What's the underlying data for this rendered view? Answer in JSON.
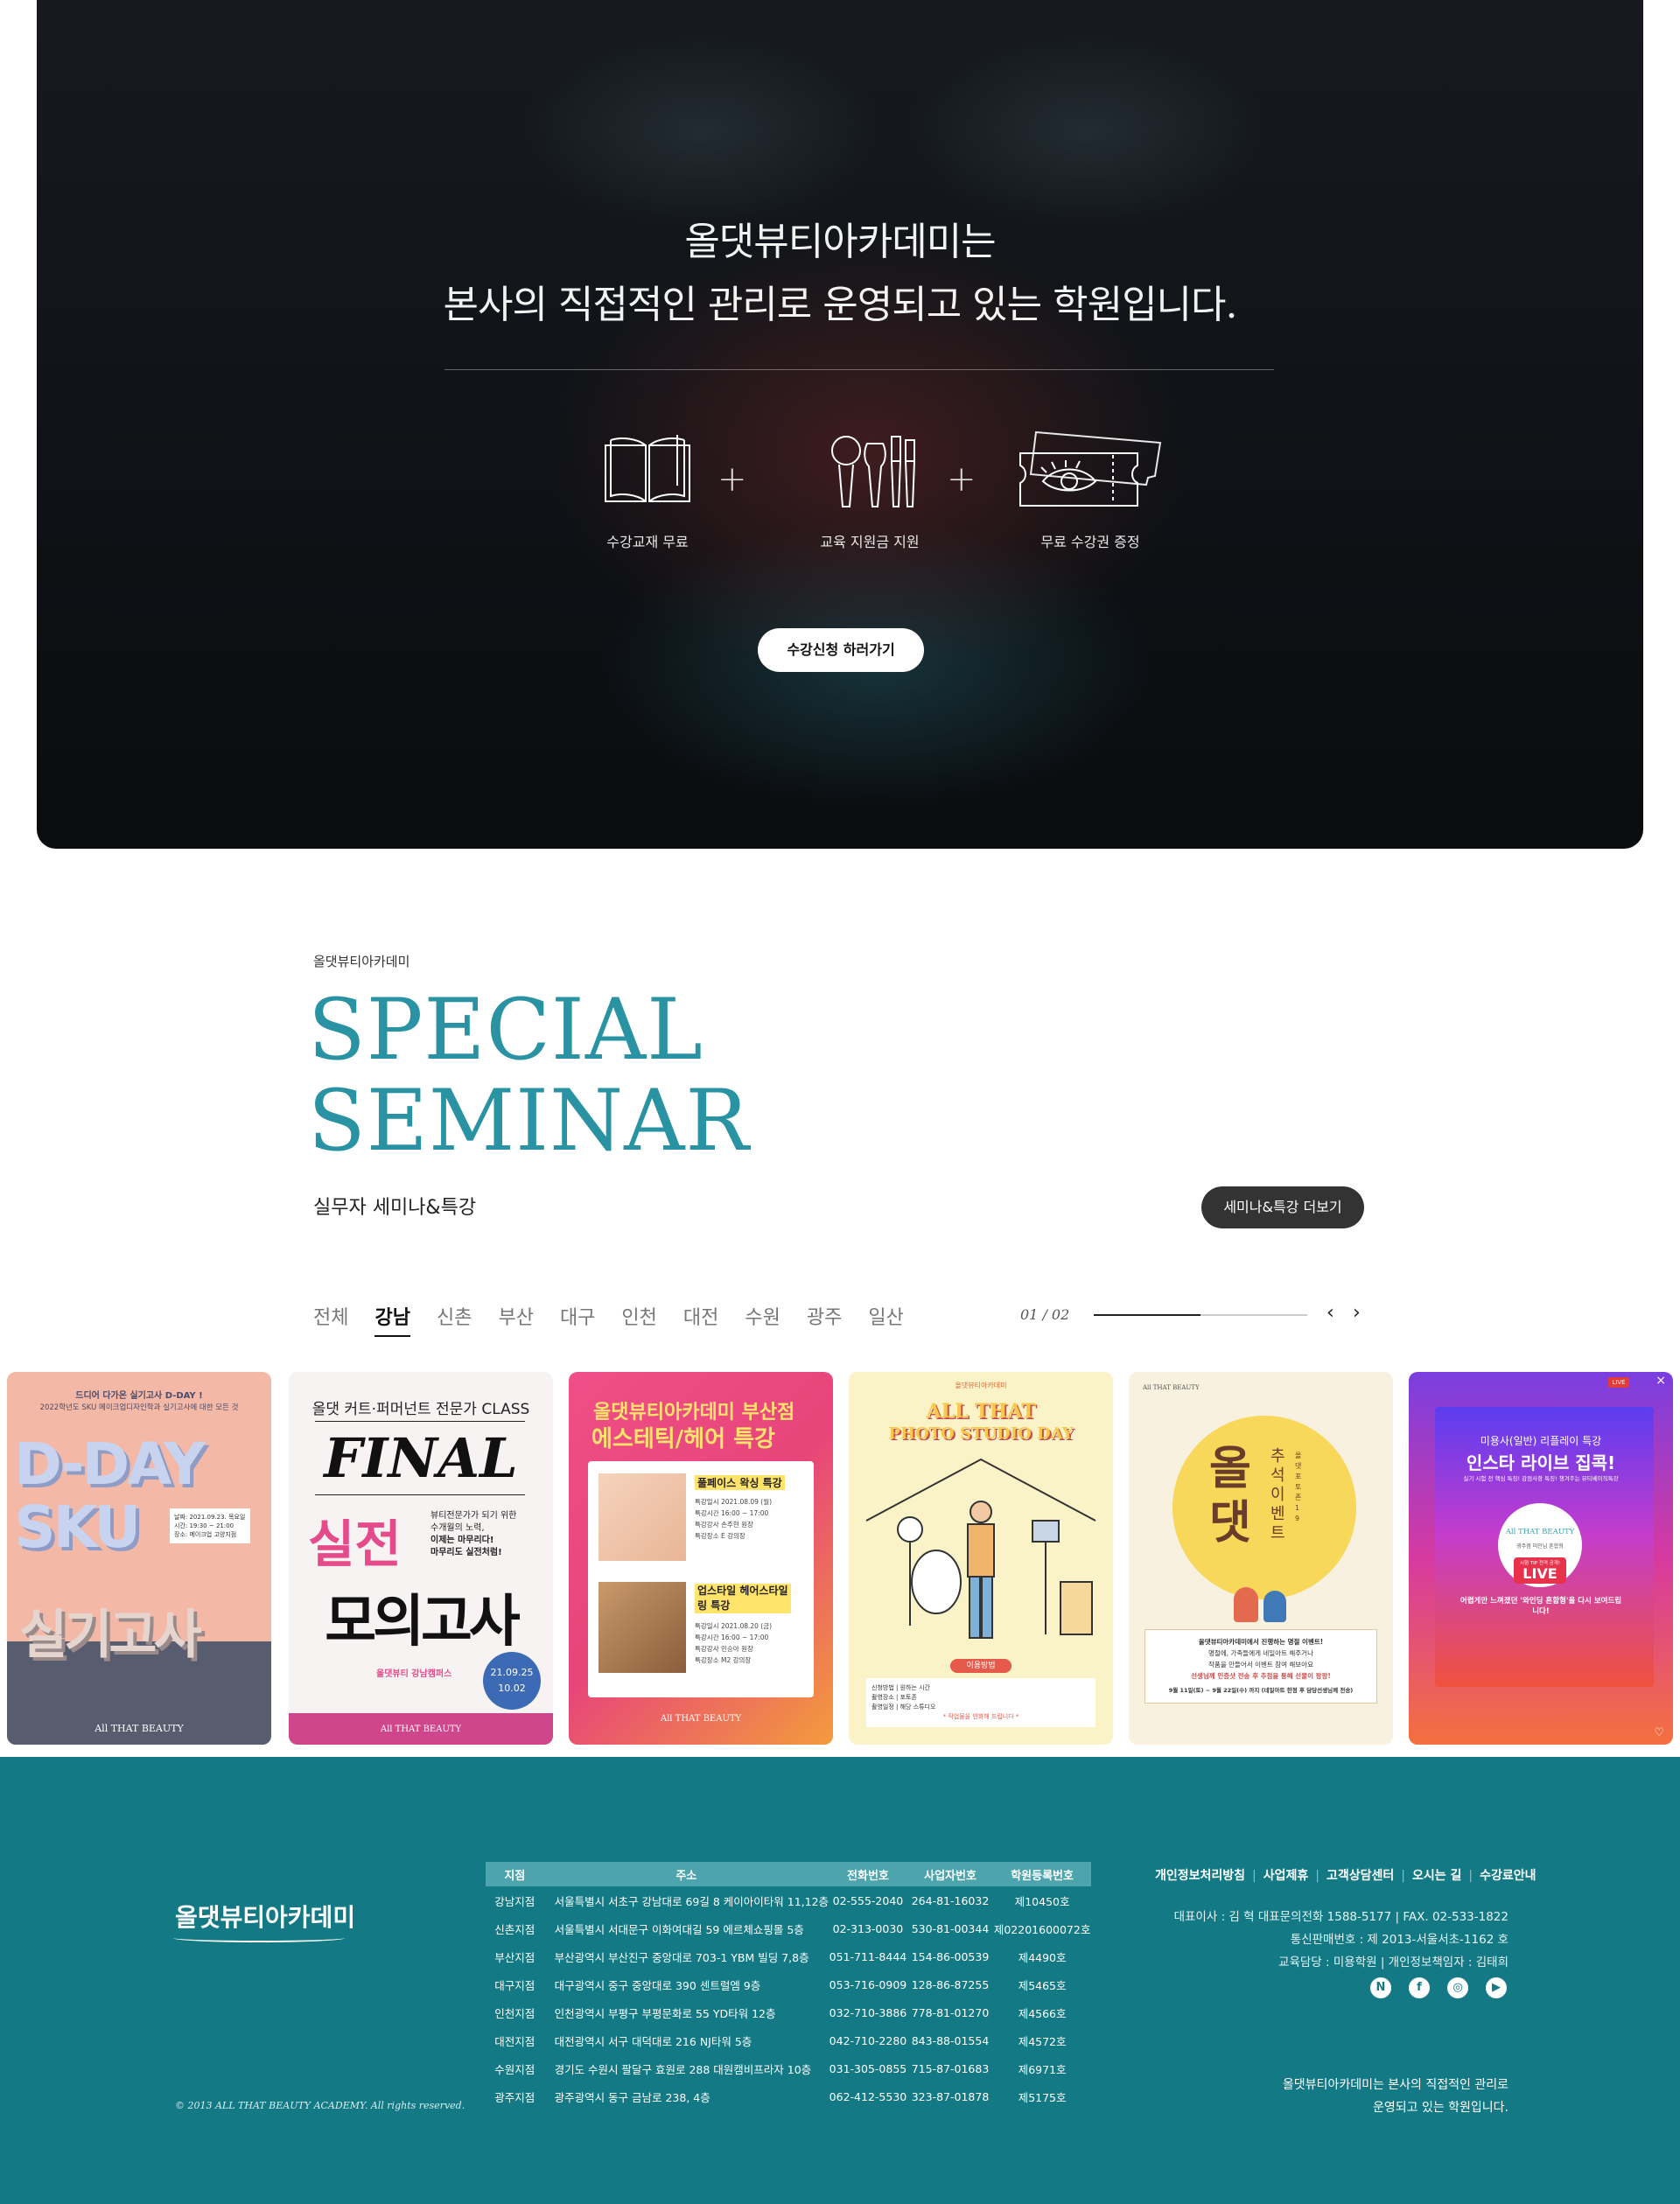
{
  "hero": {
    "title_line1": "올댓뷰티아카데미는",
    "title_line2": "본사의 직접적인 관리로 운영되고 있는 학원입니다.",
    "benefits": [
      {
        "label": "수강교재 무료",
        "icon": "book-icon"
      },
      {
        "label": "교육 지원금 지원",
        "icon": "makeup-brush-icon"
      },
      {
        "label": "무료 수강권 증정",
        "icon": "ticket-eye-icon"
      }
    ],
    "plus": "+",
    "cta_label": "수강신청 하러가기"
  },
  "seminar": {
    "sub": "올댓뷰티아카데미",
    "title_line1": "SPECIAL",
    "title_line2": "SEMINAR",
    "desc": "실무자 세미나&특강",
    "more_label": "세미나&특강 더보기",
    "tabs": [
      "전체",
      "강남",
      "신촌",
      "부산",
      "대구",
      "인천",
      "대전",
      "수원",
      "광주",
      "일산"
    ],
    "active_tab": "강남",
    "pager": "01 / 02",
    "progress": 0.5,
    "prev_icon": "‹",
    "next_icon": "›",
    "cards": [
      {
        "top1": "드디어 다가온 실기고사 D-DAY !",
        "top2": "2022학년도 SKU 메이크업디자인학과 실기고사에 대한 모든 것",
        "big": [
          "D-DAY",
          "SKU",
          "실기고사"
        ],
        "info": [
          "날짜: 2021.09.23. 목요일",
          "시간: 19:30 ~ 21:00",
          "장소: 메이크업 고양지점"
        ],
        "brand": "All THAT BEAUTY"
      },
      {
        "head": "올댓 커트·퍼머넌트 전문가 CLASS",
        "final": "FINAL",
        "red": "실전",
        "msg": [
          "뷰티전문가가 되기 위한",
          "수개월의 노력,",
          "이제는 마무리다!",
          "마무리도 실전처럼!"
        ],
        "big": "모의고사",
        "campus": "올댓뷰티 강남캠퍼스",
        "dates": [
          "21.09.25",
          "10.02"
        ],
        "brand": "All THAT BEAUTY"
      },
      {
        "head1": "올댓뷰티아카데미 부산점",
        "head2": "에스테틱/헤어 특강",
        "sec1_title": "풀페이스 왁싱 특강",
        "sec1_lines": [
          "특강일시 2021.08.09 (월)",
          "특강시간 16:00 ~ 17:00",
          "특강강사 손주현 원장",
          "특강장소 E 강의장"
        ],
        "sec2_title": "업스타일 헤어스타일링 특강",
        "sec2_lines": [
          "특강일시 2021.08.20 (금)",
          "특강시간 16:00 ~ 17:00",
          "특강강사 민승아 원장",
          "특강장소 M2 강의장"
        ],
        "brand": "All THAT BEAUTY"
      },
      {
        "sub": "올댓뷰티아카데미",
        "head1": "ALL THAT",
        "head2": "PHOTO STUDIO DAY",
        "method": "이용방법",
        "lines": [
          "신청방법 | 원하는 시간",
          "촬영장소 | 포토존",
          "촬영일정 | 해당 스튜디오",
          "* 작업물을 인화해 드립니다 *"
        ]
      },
      {
        "brand": "All THAT BEAUTY",
        "big": "올댓",
        "side1": "추석이벤트",
        "side2": "올댓 포토존 1 9",
        "msg": [
          "올댓뷰티아카데미에서 진행하는 명절 이벤트!",
          "명절에, 가족들에게 네일아트 해주거나",
          "작품을 만들어서 이벤트 참여 해보아요",
          "선생님께 인증샷 전송 후 추첨을 통해 선물이 팡팡!"
        ],
        "date": "9월 11일(토) ~ 9월 22일(수) 까지 (네일아트 한정 후 담당선생님께 전송)"
      },
      {
        "head1": "미용사(일반) 리플레이 특강",
        "head2": "인스타 라이브 집콕!",
        "desc": "실기 시험 전 핵심 특징! 감점사항 특징! 챙겨주는 뷰티베이직특강",
        "logo": "All THAT BEAUTY",
        "logo_sub": "광주점 미인님 혼합형",
        "live": "LIVE",
        "live_sub": "시험 TIP 전격 공개!",
        "cta": "어렵게만 느껴졌던 '와인딩 혼합형'을 다시 보여드립니다!",
        "live_badge": "LIVE"
      }
    ]
  },
  "footer": {
    "logo": "올댓뷰티아카데미",
    "copyright": "© 2013 ALL THAT BEAUTY ACADEMY. All rights reserved.",
    "table_headers": [
      "지점",
      "주소",
      "전화번호",
      "사업자번호",
      "학원등록번호"
    ],
    "rows": [
      [
        "강남지점",
        "서울특별시 서초구 강남대로 69길 8 케이아이타워 11,12층",
        "02-555-2040",
        "264-81-16032",
        "제10450호"
      ],
      [
        "신촌지점",
        "서울특별시 서대문구 이화여대길 59 에르체쇼핑몰 5층",
        "02-313-0030",
        "530-81-00344",
        "제02201600072호"
      ],
      [
        "부산지점",
        "부산광역시 부산진구 중앙대로 703-1 YBM 빌딩 7,8층",
        "051-711-8444",
        "154-86-00539",
        "제4490호"
      ],
      [
        "대구지점",
        "대구광역시 중구 중앙대로 390 센트럴엠 9층",
        "053-716-0909",
        "128-86-87255",
        "제5465호"
      ],
      [
        "인천지점",
        "인천광역시 부평구 부평문화로 55 YD타워 12층",
        "032-710-3886",
        "778-81-01270",
        "제4566호"
      ],
      [
        "대전지점",
        "대전광역시 서구 대덕대로 216 NJ타워 5층",
        "042-710-2280",
        "843-88-01554",
        "제4572호"
      ],
      [
        "수원지점",
        "경기도 수원시 팔달구 효원로 288 대원캠비프라자 10층",
        "031-305-0855",
        "715-87-01683",
        "제6971호"
      ],
      [
        "광주지점",
        "광주광역시 동구 금남로 238, 4층",
        "062-412-5530",
        "323-87-01878",
        "제5175호"
      ]
    ],
    "links": [
      "개인정보처리방침",
      "사업제휴",
      "고객상담센터",
      "오시는 길",
      "수강료안내"
    ],
    "info": [
      "대표이사 : 김 혁 대표문의전화 1588-5177 | FAX. 02-533-1822",
      "통신판매번호 : 제 2013-서울서초-1162 호",
      "교육담당 : 미용학원 | 개인정보책임자 : 김태희"
    ],
    "social": [
      {
        "icon": "naver-icon",
        "glyph": "N"
      },
      {
        "icon": "facebook-icon",
        "glyph": "f"
      },
      {
        "icon": "instagram-icon",
        "glyph": "◎"
      },
      {
        "icon": "youtube-icon",
        "glyph": "▶"
      }
    ],
    "tagline1": "올댓뷰티아카데미는 본사의 직접적인 관리로",
    "tagline2": "운영되고 있는 학원입니다."
  }
}
